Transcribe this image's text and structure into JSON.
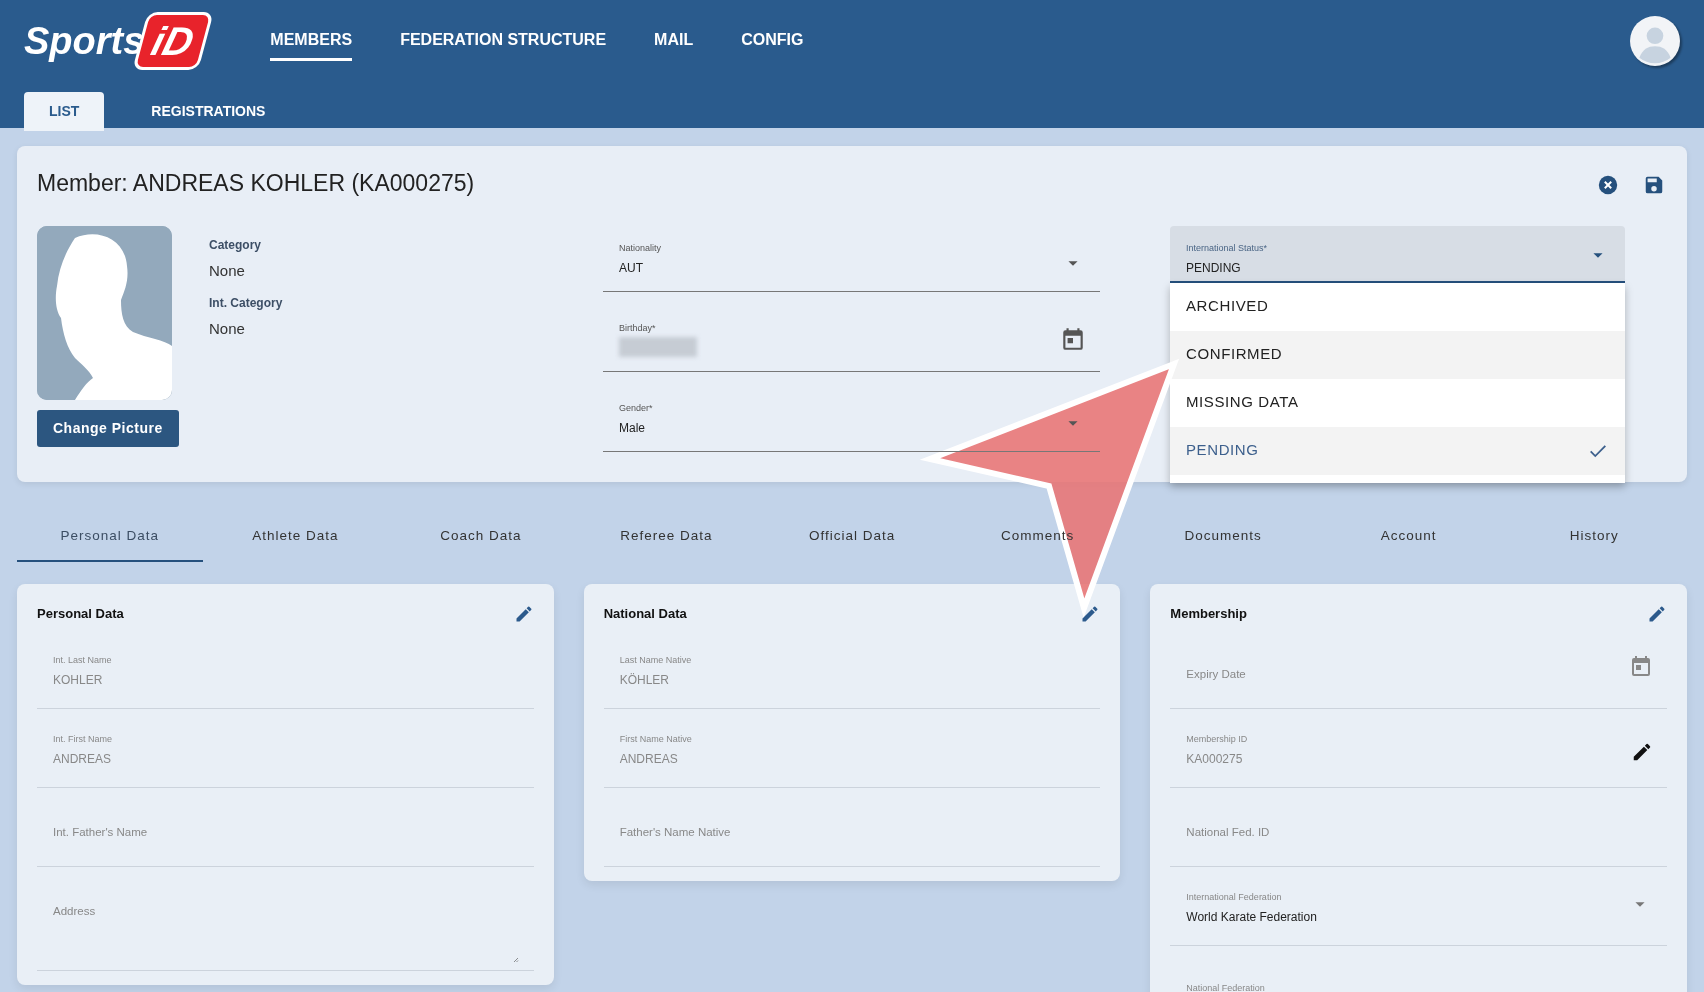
{
  "header": {
    "logo_text": "Sports",
    "logo_badge": "iD",
    "nav": [
      {
        "label": "MEMBERS",
        "selected": true
      },
      {
        "label": "FEDERATION STRUCTURE",
        "selected": false
      },
      {
        "label": "MAIL",
        "selected": false
      },
      {
        "label": "CONFIG",
        "selected": false
      }
    ],
    "subtabs": [
      {
        "label": "LIST",
        "selected": true
      },
      {
        "label": "REGISTRATIONS",
        "selected": false
      }
    ]
  },
  "member": {
    "title": "Member: ANDREAS KOHLER (KA000275)",
    "button": "Change Picture",
    "info": [
      {
        "label": "Category",
        "value": "None"
      },
      {
        "label": "Int. Category",
        "value": "None"
      }
    ],
    "fields": [
      {
        "kind": "select",
        "label": "Nationality",
        "value": "AUT"
      },
      {
        "kind": "date",
        "label": "Birthday*",
        "blurred": true
      },
      {
        "kind": "select",
        "label": "Gender*",
        "value": "Male"
      }
    ],
    "status": {
      "label": "International Status*",
      "value": "PENDING",
      "expanded": true,
      "options": [
        {
          "label": "ARCHIVED",
          "selected": false,
          "hovered": false
        },
        {
          "label": "CONFIRMED",
          "selected": false,
          "hovered": true
        },
        {
          "label": "MISSING DATA",
          "selected": false,
          "hovered": false
        },
        {
          "label": "PENDING",
          "selected": true,
          "hovered": false
        }
      ]
    }
  },
  "tabs": [
    {
      "label": "Personal Data",
      "selected": true
    },
    {
      "label": "Athlete Data",
      "selected": false
    },
    {
      "label": "Coach Data",
      "selected": false
    },
    {
      "label": "Referee Data",
      "selected": false
    },
    {
      "label": "Official Data",
      "selected": false
    },
    {
      "label": "Comments",
      "selected": false
    },
    {
      "label": "Documents",
      "selected": false
    },
    {
      "label": "Account",
      "selected": false
    },
    {
      "label": "History",
      "selected": false
    }
  ],
  "panels": [
    {
      "title": "Personal Data",
      "fields": [
        {
          "kind": "text",
          "label": "Int. Last Name",
          "value": "KOHLER",
          "disabled": true
        },
        {
          "kind": "text",
          "label": "Int. First Name",
          "value": "ANDREAS",
          "disabled": true
        },
        {
          "kind": "text",
          "placeholder": "Int. Father's Name"
        },
        {
          "kind": "textarea",
          "placeholder": "Address"
        }
      ]
    },
    {
      "title": "National Data",
      "fields": [
        {
          "kind": "text",
          "label": "Last Name Native",
          "value": "KÖHLER",
          "disabled": true
        },
        {
          "kind": "text",
          "label": "First Name Native",
          "value": "ANDREAS",
          "disabled": true
        },
        {
          "kind": "text",
          "placeholder": "Father's Name Native"
        }
      ]
    },
    {
      "title": "Membership",
      "fields": [
        {
          "kind": "date",
          "placeholder": "Expiry Date"
        },
        {
          "kind": "editable",
          "label": "Membership ID",
          "value": "KA000275",
          "disabled": true
        },
        {
          "kind": "text",
          "placeholder": "National Fed. ID"
        },
        {
          "kind": "select",
          "label": "International Federation",
          "value": "World Karate Federation",
          "disabled": false
        },
        {
          "kind": "cut",
          "label": "National Federation"
        }
      ]
    }
  ]
}
